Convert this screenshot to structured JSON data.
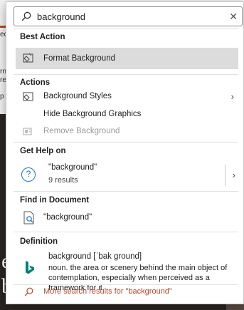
{
  "search": {
    "value": "background"
  },
  "background_fragments": {
    "tab": "ecc",
    "small1": "rn",
    "small2": "re",
    "small3": "p",
    "big1": "e",
    "big2": "b"
  },
  "best_action": {
    "heading": "Best Action",
    "item": "Format Background"
  },
  "actions": {
    "heading": "Actions",
    "items": [
      {
        "label": "Background Styles",
        "icon": "background-styles-icon",
        "submenu": true,
        "disabled": false
      },
      {
        "label": "Hide Background Graphics",
        "icon": "",
        "submenu": false,
        "disabled": false
      },
      {
        "label": "Remove Background",
        "icon": "remove-background-icon",
        "submenu": false,
        "disabled": true
      }
    ]
  },
  "get_help": {
    "heading": "Get Help on",
    "title": "\"background\"",
    "subtitle": "9 results"
  },
  "find_in_document": {
    "heading": "Find in Document",
    "item": "\"background\""
  },
  "definition": {
    "heading": "Definition",
    "word": "background [ˈbak ground]",
    "text": "noun. the area or scenery behind the main object of contemplation, especially when perceived as a framework for it."
  },
  "more_results": "More search results for \"background\"",
  "colors": {
    "accent": "#b7472a",
    "help_blue": "#1a73c8",
    "bing_teal": "#008373",
    "highlight": "#dcdcdc"
  }
}
